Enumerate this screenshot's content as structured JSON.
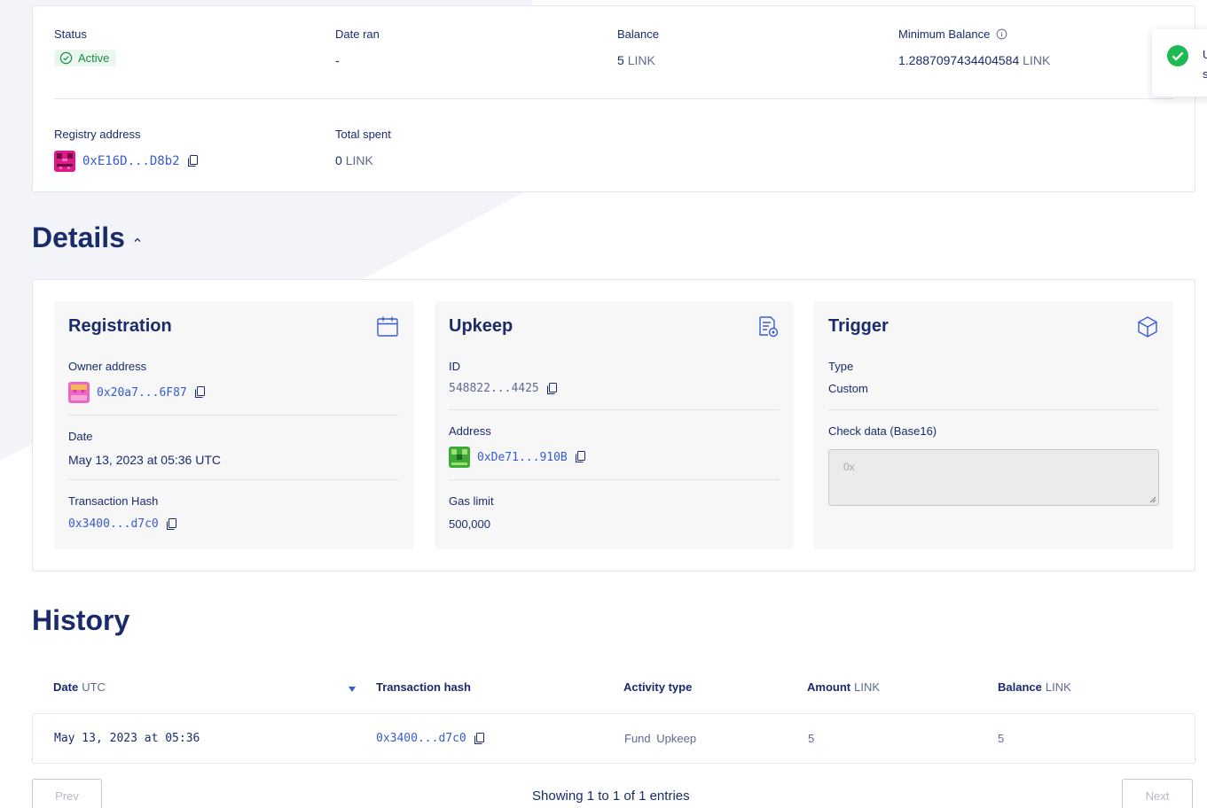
{
  "summary": {
    "status_label": "Status",
    "status_value": "Active",
    "date_ran_label": "Date ran",
    "date_ran_value": "-",
    "balance_label": "Balance",
    "balance_amount": "5",
    "balance_unit": "LINK",
    "min_balance_label": "Minimum Balance",
    "min_balance_amount": "1.2887097434404584",
    "min_balance_unit": "LINK",
    "registry_label": "Registry address",
    "registry_value": "0xE16D...D8b2",
    "total_spent_label": "Total spent",
    "total_spent_amount": "0",
    "total_spent_unit": "LINK"
  },
  "details": {
    "title": "Details",
    "registration": {
      "title": "Registration",
      "owner_label": "Owner address",
      "owner_value": "0x20a7...6F87",
      "date_label": "Date",
      "date_value": "May 13, 2023 at 05:36 UTC",
      "tx_label": "Transaction Hash",
      "tx_value": "0x3400...d7c0"
    },
    "upkeep": {
      "title": "Upkeep",
      "id_label": "ID",
      "id_value": "548822...4425",
      "address_label": "Address",
      "address_value": "0xDe71...910B",
      "gas_label": "Gas limit",
      "gas_value": "500,000"
    },
    "trigger": {
      "title": "Trigger",
      "type_label": "Type",
      "type_value": "Custom",
      "check_label": "Check data (Base16)",
      "check_placeholder": "0x"
    }
  },
  "history": {
    "title": "History",
    "columns": [
      {
        "label": "Date",
        "unit": "UTC"
      },
      {
        "label": "Transaction hash",
        "unit": ""
      },
      {
        "label": "Activity type",
        "unit": ""
      },
      {
        "label": "Amount",
        "unit": "LINK"
      },
      {
        "label": "Balance",
        "unit": "LINK"
      }
    ],
    "rows": [
      {
        "date": "May 13, 2023 at 05:36",
        "tx": "0x3400...d7c0",
        "activity": "Fund Upkeep",
        "amount": "5",
        "balance": "5"
      }
    ],
    "prev_label": "Prev",
    "next_label": "Next",
    "showing_text": "Showing 1 to 1 of 1 entries"
  },
  "toast": {
    "line1": "U",
    "line2": "s"
  },
  "colors": {
    "primary": "#1a2b6b",
    "link": "#375bd2",
    "success": "#1b8a43",
    "toast_check": "#1fba55"
  }
}
